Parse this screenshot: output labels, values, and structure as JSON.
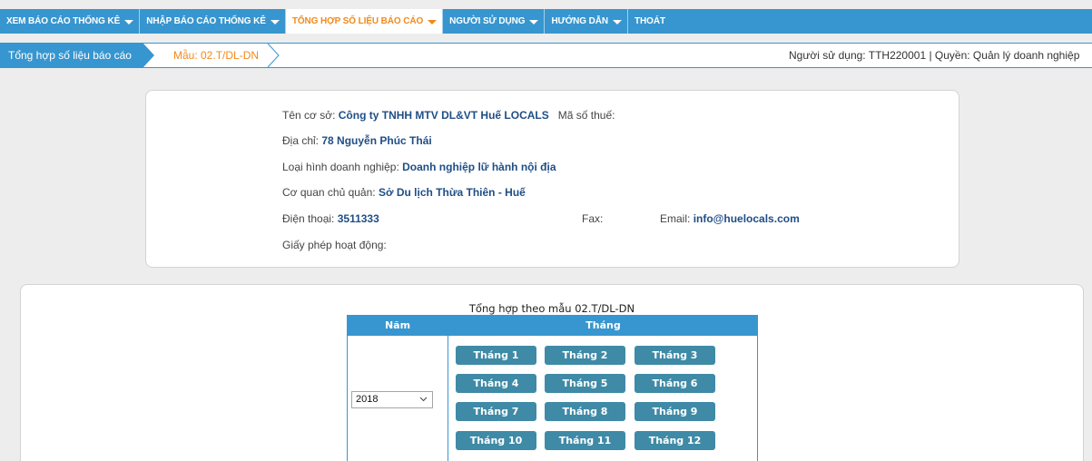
{
  "nav": {
    "items": [
      {
        "label": "XEM BÁO CÁO THỐNG KÊ",
        "has_caret": true
      },
      {
        "label": "NHẬP BÁO CÁO THỐNG KÊ",
        "has_caret": true
      },
      {
        "label": "TỔNG HỢP SỐ LIỆU BÁO CÁO",
        "has_caret": true,
        "active": true
      },
      {
        "label": "NGƯỜI SỬ DỤNG",
        "has_caret": true
      },
      {
        "label": "HƯỚNG DẪN",
        "has_caret": true
      },
      {
        "label": "THOÁT",
        "has_caret": false
      }
    ]
  },
  "breadcrumb": {
    "section": "Tổng hợp số liệu báo cáo",
    "current": "Mẫu: 02.T/DL-DN"
  },
  "user_info": "Người sử dụng: TTH220001 | Quyền: Quản lý doanh nghiệp",
  "company": {
    "name_label": "Tên cơ sở:",
    "name": "Công ty TNHH MTV DL&VT Huế LOCALS",
    "tax_label": "Mã số thuế:",
    "tax": "",
    "address_label": "Địa chỉ:",
    "address": "78 Nguyễn Phúc Thái",
    "type_label": "Loại hình doanh nghiệp:",
    "type": "Doanh nghiệp lữ hành nội địa",
    "agency_label": "Cơ quan chủ quản:",
    "agency": "Sở Du lịch Thừa Thiên - Huế",
    "phone_label": "Điện thoại:",
    "phone": "3511333",
    "fax_label": "Fax:",
    "fax": "",
    "email_label": "Email:",
    "email": "info@huelocals.com",
    "license_label": "Giấy phép hoạt động:",
    "license": ""
  },
  "summary": {
    "title": "Tổng hợp theo mẫu 02.T/DL-DN",
    "col_year": "Năm",
    "col_month": "Tháng",
    "year_selected": "2018",
    "months": [
      "Tháng 1",
      "Tháng 2",
      "Tháng 3",
      "Tháng 4",
      "Tháng 5",
      "Tháng 6",
      "Tháng 7",
      "Tháng 8",
      "Tháng 9",
      "Tháng 10",
      "Tháng 11",
      "Tháng 12"
    ]
  },
  "colors": {
    "primary": "#3796cf",
    "accent": "#f08a1c",
    "month_button": "#3f8aa6",
    "value_text": "#1f4e86"
  }
}
